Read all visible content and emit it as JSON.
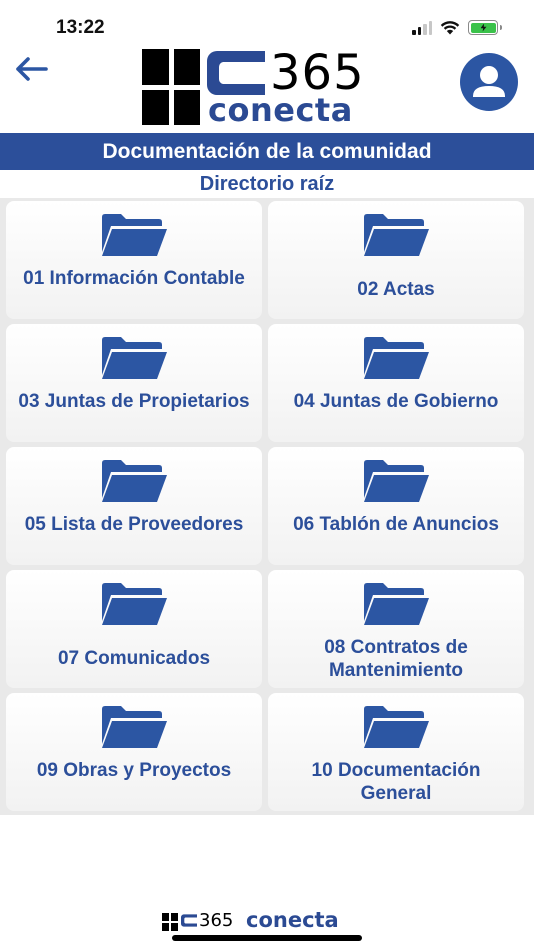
{
  "status_bar": {
    "time": "13:22"
  },
  "header": {
    "logo": {
      "mark": "C",
      "number": "365",
      "wordmark": "conecta"
    },
    "back_icon": "arrow-left-icon",
    "profile_icon": "user-icon"
  },
  "page": {
    "title": "Documentación de la comunidad",
    "subtitle": "Directorio raíz"
  },
  "folders": [
    {
      "label": "01 Información Contable",
      "icon": "folder-icon"
    },
    {
      "label": "02 Actas",
      "icon": "folder-icon"
    },
    {
      "label": "03 Juntas de Propietarios",
      "icon": "folder-icon"
    },
    {
      "label": "04 Juntas de Gobierno",
      "icon": "folder-icon"
    },
    {
      "label": "05 Lista de Proveedores",
      "icon": "folder-icon"
    },
    {
      "label": "06 Tablón de Anuncios",
      "icon": "folder-icon"
    },
    {
      "label": "07 Comunicados",
      "icon": "folder-icon"
    },
    {
      "label": "08 Contratos de Mantenimiento",
      "icon": "folder-icon"
    },
    {
      "label": "09 Obras y Proyectos",
      "icon": "folder-icon"
    },
    {
      "label": "10 Documentación General",
      "icon": "folder-icon"
    }
  ],
  "footer": {
    "number": "365",
    "wordmark": "conecta"
  },
  "colors": {
    "brand_blue": "#2c4f9a",
    "grid_background": "#e9e9e9",
    "card_background": "#ffffff",
    "folder_icon": "#2c56a3"
  }
}
